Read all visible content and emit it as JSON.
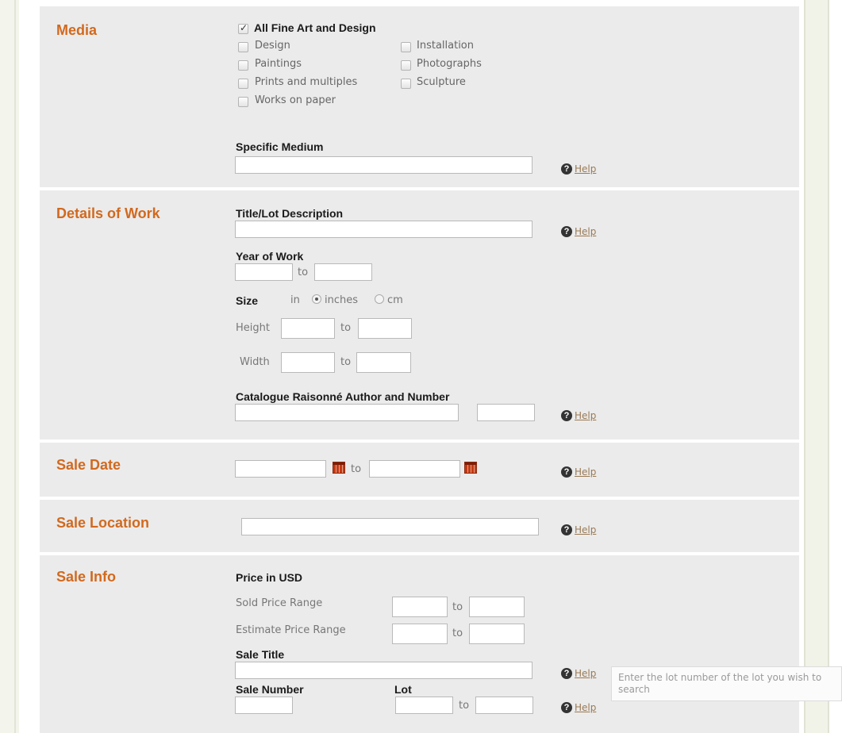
{
  "sections": {
    "media": {
      "title": "Media",
      "all_label": "All Fine Art and Design",
      "all_checked": true,
      "options": [
        "Design",
        "Installation",
        "Paintings",
        "Photographs",
        "Prints and multiples",
        "Sculpture",
        "Works on paper"
      ],
      "specific_medium_label": "Specific Medium",
      "specific_medium_value": ""
    },
    "details": {
      "title": "Details of Work",
      "title_lot_label": "Title/Lot Description",
      "year_label": "Year of Work",
      "to": "to",
      "size_label": "Size",
      "size_in": "in",
      "unit_inches": "inches",
      "unit_cm": "cm",
      "selected_unit": "inches",
      "height_label": "Height",
      "width_label": "Width",
      "catalogue_label": "Catalogue Raisonné Author and Number"
    },
    "sale_date": {
      "title": "Sale Date",
      "to": "to"
    },
    "sale_location": {
      "title": "Sale Location"
    },
    "sale_info": {
      "title": "Sale Info",
      "price_label": "Price in USD",
      "sold_range_label": "Sold Price Range",
      "estimate_range_label": "Estimate Price Range",
      "to": "to",
      "sale_title_label": "Sale Title",
      "sale_number_label": "Sale Number",
      "lot_label": "Lot"
    }
  },
  "help_label": "Help",
  "tooltip_text": "Enter the lot number of the lot you wish to search",
  "colors": {
    "section_title": "#d2691e",
    "panel_bg": "#ebebeb",
    "help_link": "#9a7a55"
  }
}
